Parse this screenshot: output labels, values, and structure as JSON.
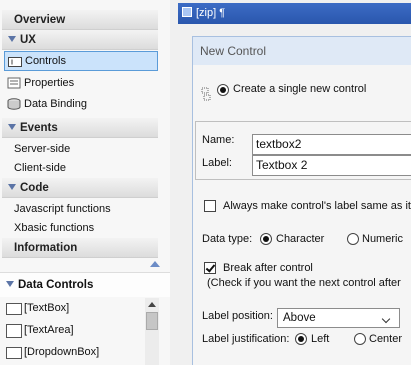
{
  "left_panel": {
    "sections": {
      "overview": "Overview",
      "ux": "UX",
      "events": "Events",
      "code": "Code",
      "information": "Information",
      "data_controls": "Data Controls"
    },
    "ux_items": [
      "Controls",
      "Properties",
      "Data Binding"
    ],
    "event_items": [
      "Server-side",
      "Client-side"
    ],
    "code_items": [
      "Javascript functions",
      "Xbasic functions"
    ],
    "data_control_items": [
      "[TextBox]",
      "[TextArea]",
      "[DropdownBox]"
    ]
  },
  "zip_bar": {
    "label": "[zip] ¶"
  },
  "dialog": {
    "title": "New Control",
    "create_single_label": "Create a single new control",
    "name_label": "Name:",
    "name_value": "textbox2",
    "label_label": "Label:",
    "label_value": "Textbox 2",
    "same_label_text": "Always make control's label same as its n",
    "data_type_label": "Data type:",
    "data_type_options": [
      "Character",
      "Numeric"
    ],
    "break_after_label": "Break after control",
    "break_after_hint": "(Check if you want the next control after",
    "label_position_label": "Label position:",
    "label_position_value": "Above",
    "label_justification_label": "Label justification:",
    "label_justification_options": [
      "Left",
      "Center"
    ]
  }
}
